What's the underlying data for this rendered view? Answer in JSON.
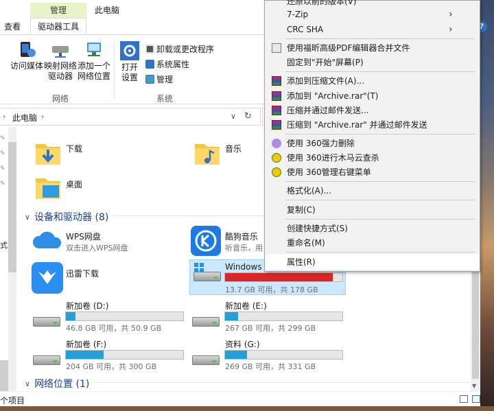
{
  "window": {
    "title": "此电脑",
    "tab_manage": "管理",
    "tab_drive_tools": "驱动器工具",
    "tab_view": "查看",
    "close_glyph": "✕",
    "expand_glyph": "⌃",
    "help_glyph": "?"
  },
  "ribbon": {
    "access_media": "访问媒体",
    "map_drive_1": "映射网络",
    "map_drive_2": "驱动器",
    "add_location_1": "添加一个",
    "add_location_2": "网络位置",
    "group_network": "网络",
    "open_settings_1": "打开",
    "open_settings_2": "设置",
    "uninstall": "卸载或更改程序",
    "sys_props": "系统属性",
    "manage": "管理",
    "group_system": "系统"
  },
  "address": {
    "arrow": "›",
    "path": "此电脑",
    "chev": "›",
    "dropdown": "∨",
    "refresh": "↻"
  },
  "nav": {
    "snippet": "式"
  },
  "folders": [
    {
      "name": "下载"
    },
    {
      "name": "音乐"
    },
    {
      "name": "桌面"
    }
  ],
  "sections": {
    "devices": "设备和驱动器 (8)",
    "network": "网络位置 (1)",
    "chev_glyph": "∨"
  },
  "apps": {
    "wps_name": "WPS网盘",
    "wps_sub": "双击进入WPS网盘",
    "kugou_name": "酷狗音乐",
    "kugou_sub": "听音乐，用",
    "xunlei_name": "迅雷下载"
  },
  "drives": [
    {
      "name": "Windows (",
      "info": "13.7 GB 可用，共 178 GB",
      "used_fraction": 0.92,
      "critical": true
    },
    {
      "name": "新加卷 (D:)",
      "info": "46.8 GB 可用，共 50.9 GB",
      "used_fraction": 0.08,
      "critical": false
    },
    {
      "name": "新加卷 (E:)",
      "info": "267 GB 可用，共 299 GB",
      "used_fraction": 0.11,
      "critical": false
    },
    {
      "name": "新加卷 (F:)",
      "info": "204 GB 可用，共 300 GB",
      "used_fraction": 0.32,
      "critical": false
    },
    {
      "name": "资料 (G:)",
      "info": "269 GB 可用，共 331 GB",
      "used_fraction": 0.19,
      "critical": false
    }
  ],
  "status": {
    "items": "个项目"
  },
  "context_menu": {
    "items": [
      {
        "label": "还原以前的版本(V)"
      },
      {
        "label": "7-Zip",
        "submenu": "›"
      },
      {
        "label": "CRC SHA",
        "submenu": "›"
      },
      {
        "label": "使用福昕高级PDF编辑器合并文件"
      },
      {
        "label": "固定到\"开始\"屏幕(P)"
      },
      {
        "label": "添加到压缩文件(A)..."
      },
      {
        "label": "添加到 \"Archive.rar\"(T)"
      },
      {
        "label": "压缩并通过邮件发送..."
      },
      {
        "label": "压缩到 \"Archive.rar\" 并通过邮件发送"
      },
      {
        "label": "使用 360强力删除"
      },
      {
        "label": "使用 360进行木马云查杀"
      },
      {
        "label": "使用 360管理右键菜单"
      },
      {
        "label": "格式化(A)..."
      },
      {
        "label": "复制(C)"
      },
      {
        "label": "创建快捷方式(S)"
      },
      {
        "label": "重命名(M)"
      },
      {
        "label": "属性(R)"
      }
    ]
  }
}
